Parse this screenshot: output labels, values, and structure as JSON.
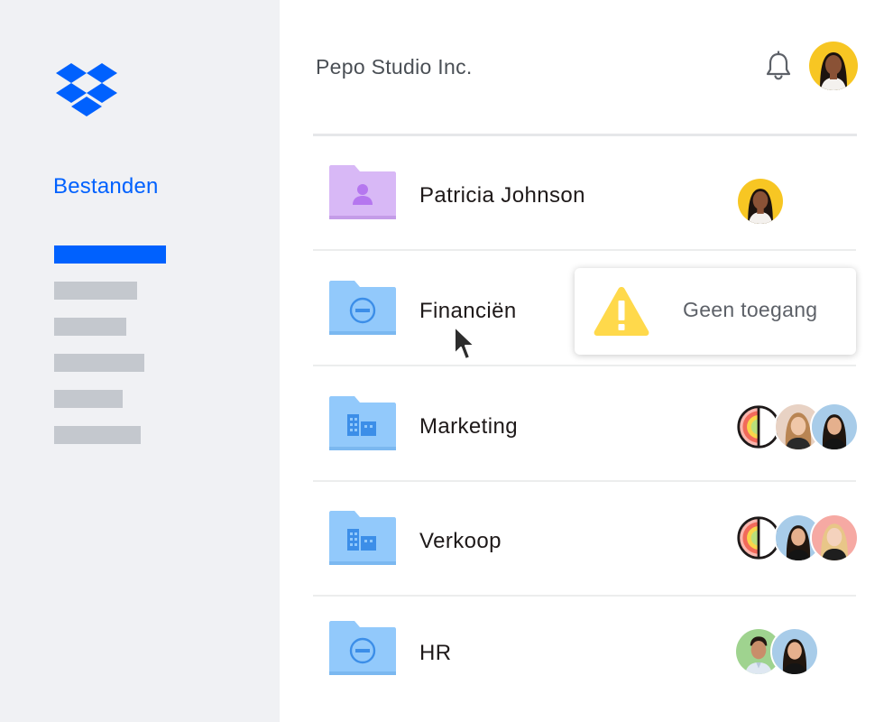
{
  "app": {
    "logo_icon": "dropbox-logo-icon",
    "brand_color": "#0061fe"
  },
  "sidebar": {
    "title": "Bestanden"
  },
  "header": {
    "account_name": "Pepo Studio Inc.",
    "notification_icon": "bell-icon",
    "avatar_icon": "user-avatar"
  },
  "folders": [
    {
      "name": "Patricia Johnson",
      "icon": "personal-folder-icon",
      "folder_color": "#d8b8f6"
    },
    {
      "name": "Financiën",
      "icon": "restricted-folder-icon",
      "folder_color": "#92c9fb"
    },
    {
      "name": "Marketing",
      "icon": "team-folder-icon",
      "folder_color": "#92c9fb"
    },
    {
      "name": "Verkoop",
      "icon": "team-folder-icon",
      "folder_color": "#92c9fb"
    },
    {
      "name": "HR",
      "icon": "restricted-folder-icon",
      "folder_color": "#92c9fb"
    }
  ],
  "tooltip": {
    "icon": "warning-icon",
    "text": "Geen toegang",
    "warning_color": "#ffd94b"
  }
}
